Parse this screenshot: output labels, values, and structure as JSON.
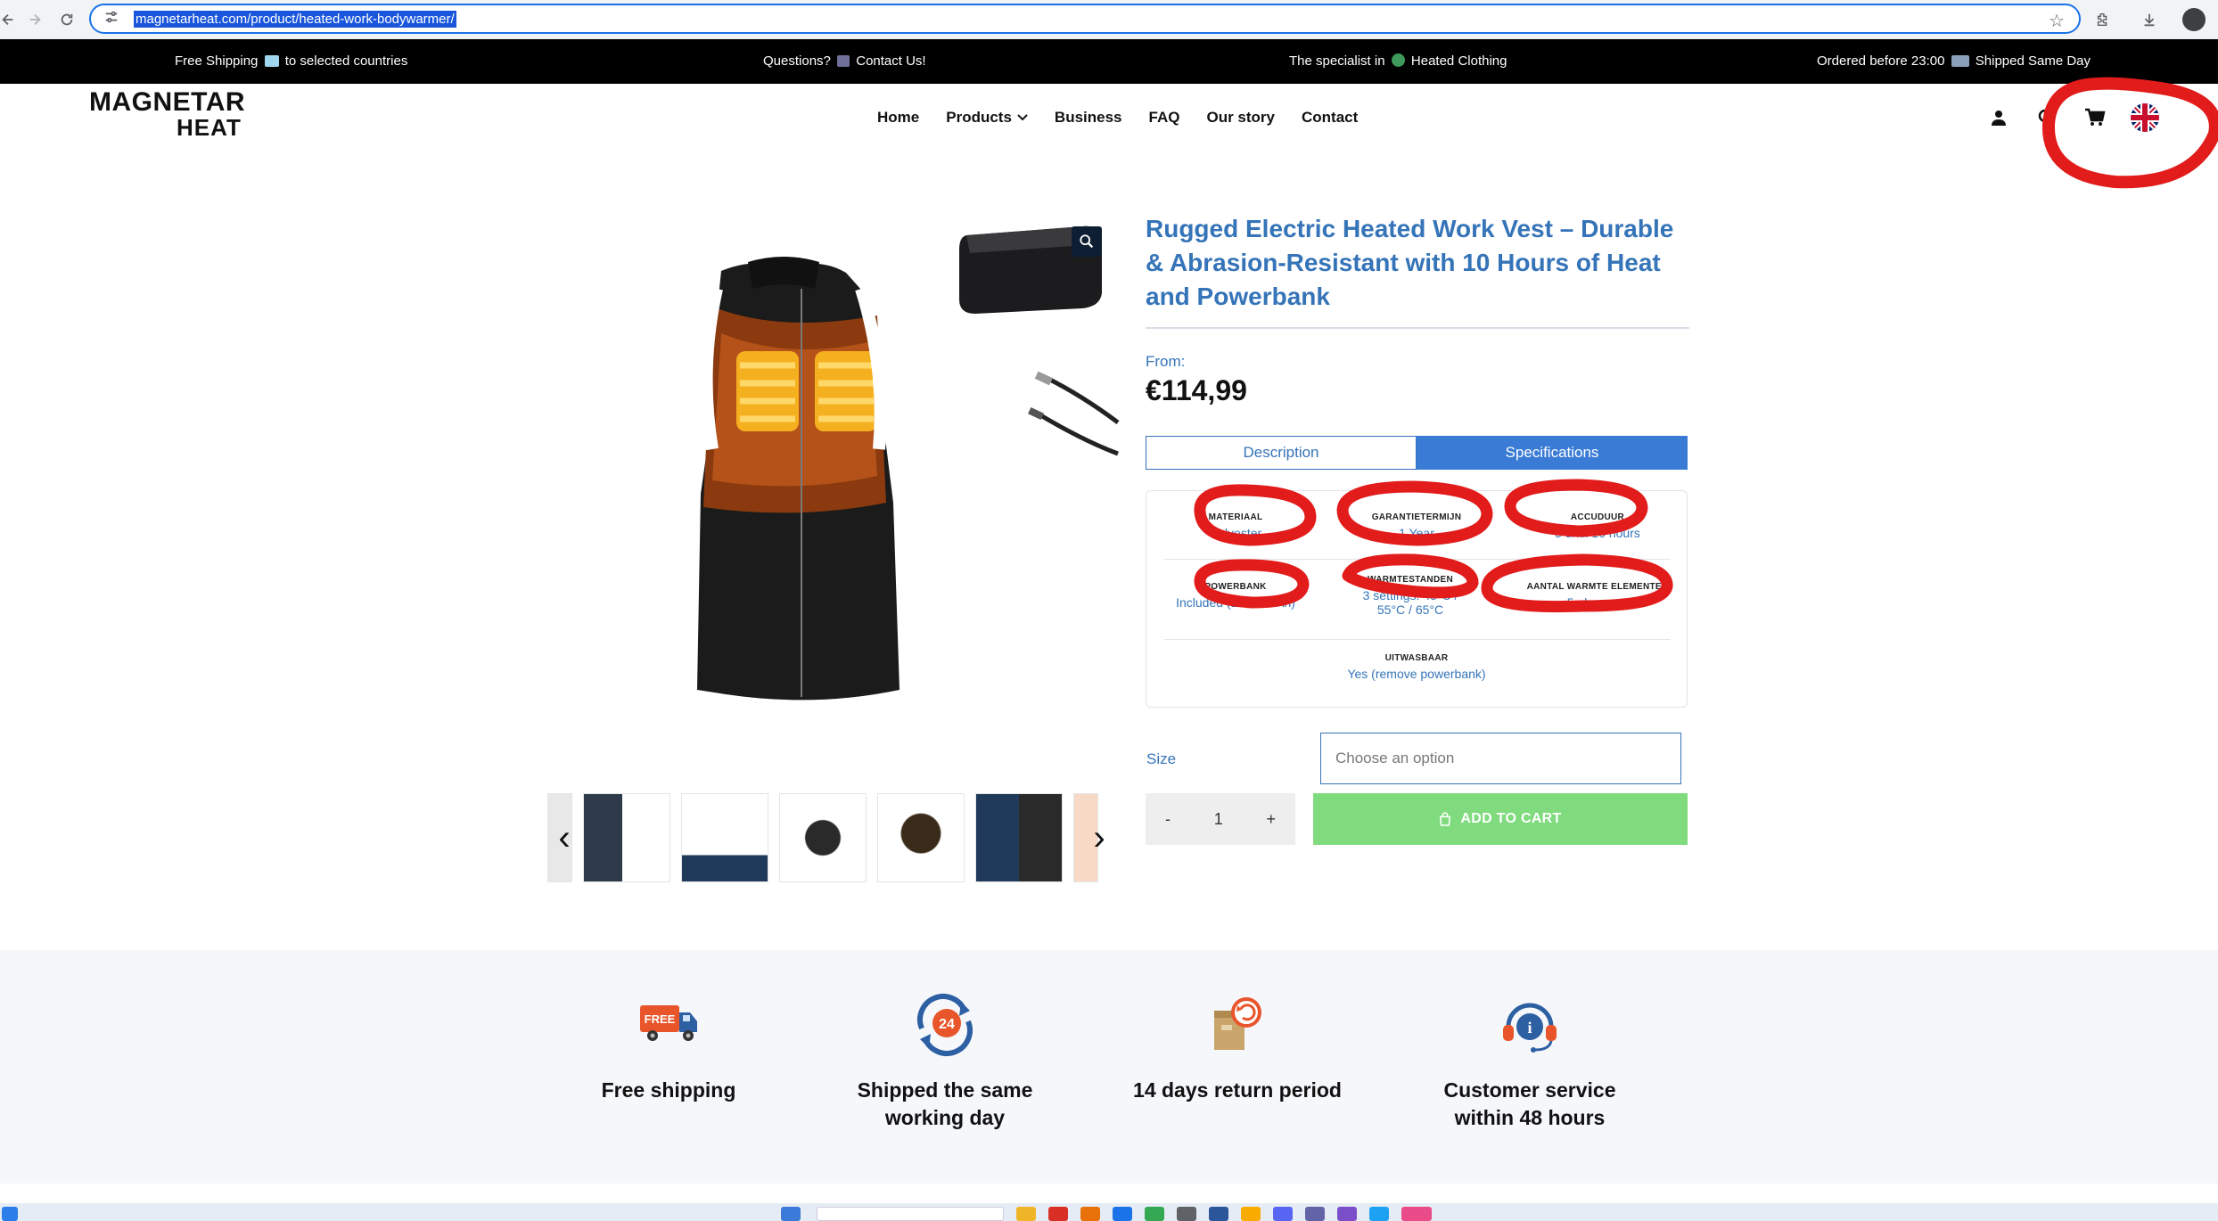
{
  "browser": {
    "url": "magnetarheat.com/product/heated-work-bodywarmer/"
  },
  "announcement": {
    "free_shipping_a": "Free Shipping",
    "free_shipping_b": "to selected countries",
    "questions_a": "Questions?",
    "questions_b": "Contact Us!",
    "specialist_a": "The specialist in",
    "specialist_b": "Heated Clothing",
    "ordered_a": "Ordered before 23:00",
    "ordered_b": "Shipped Same Day"
  },
  "logo": {
    "line1": "MAGNETAR",
    "line2": "HEAT"
  },
  "nav": {
    "home": "Home",
    "products": "Products",
    "business": "Business",
    "faq": "FAQ",
    "story": "Our story",
    "contact": "Contact"
  },
  "product": {
    "title": "Rugged Electric Heated Work Vest – Durable & Abrasion-Resistant with 10 Hours of Heat and Powerbank",
    "from_label": "From:",
    "price": "€114,99",
    "tabs": {
      "description": "Description",
      "specifications": "Specifications"
    },
    "specs": [
      {
        "label": "MATERIAAL",
        "value": "Polyester"
      },
      {
        "label": "GARANTIETERMIJN",
        "value": "1 Year"
      },
      {
        "label": "ACCUDUUR",
        "value": "5 until 10 hours"
      },
      {
        "label": "POWERBANK",
        "value": "Included (13000mAh)"
      },
      {
        "label": "WARMTESTANDEN",
        "value": "3 settings: 45°C / 55°C / 65°C"
      },
      {
        "label": "AANTAL WARMTE ELEMENTEN",
        "value": "5 elements"
      },
      {
        "label": "UITWASBAAR",
        "value": "Yes (remove powerbank)"
      }
    ],
    "size_label": "Size",
    "size_placeholder": "Choose an option",
    "qty_minus": "-",
    "qty_value": "1",
    "qty_plus": "+",
    "add_to_cart": "ADD TO CART"
  },
  "features": [
    {
      "icon": "free-shipping-truck-icon",
      "text": "Free shipping"
    },
    {
      "icon": "24h-shipping-icon",
      "text": "Shipped the same working day"
    },
    {
      "icon": "return-box-icon",
      "text": "14 days return period"
    },
    {
      "icon": "customer-service-headset-icon",
      "text": "Customer service within 48 hours"
    }
  ],
  "colors": {
    "accent_blue": "#3574b8",
    "tab_active": "#3a7bd5",
    "add_to_cart_green": "#80db7e",
    "annotation_red": "#e21b1b",
    "features_bg": "#f5f7fb"
  }
}
